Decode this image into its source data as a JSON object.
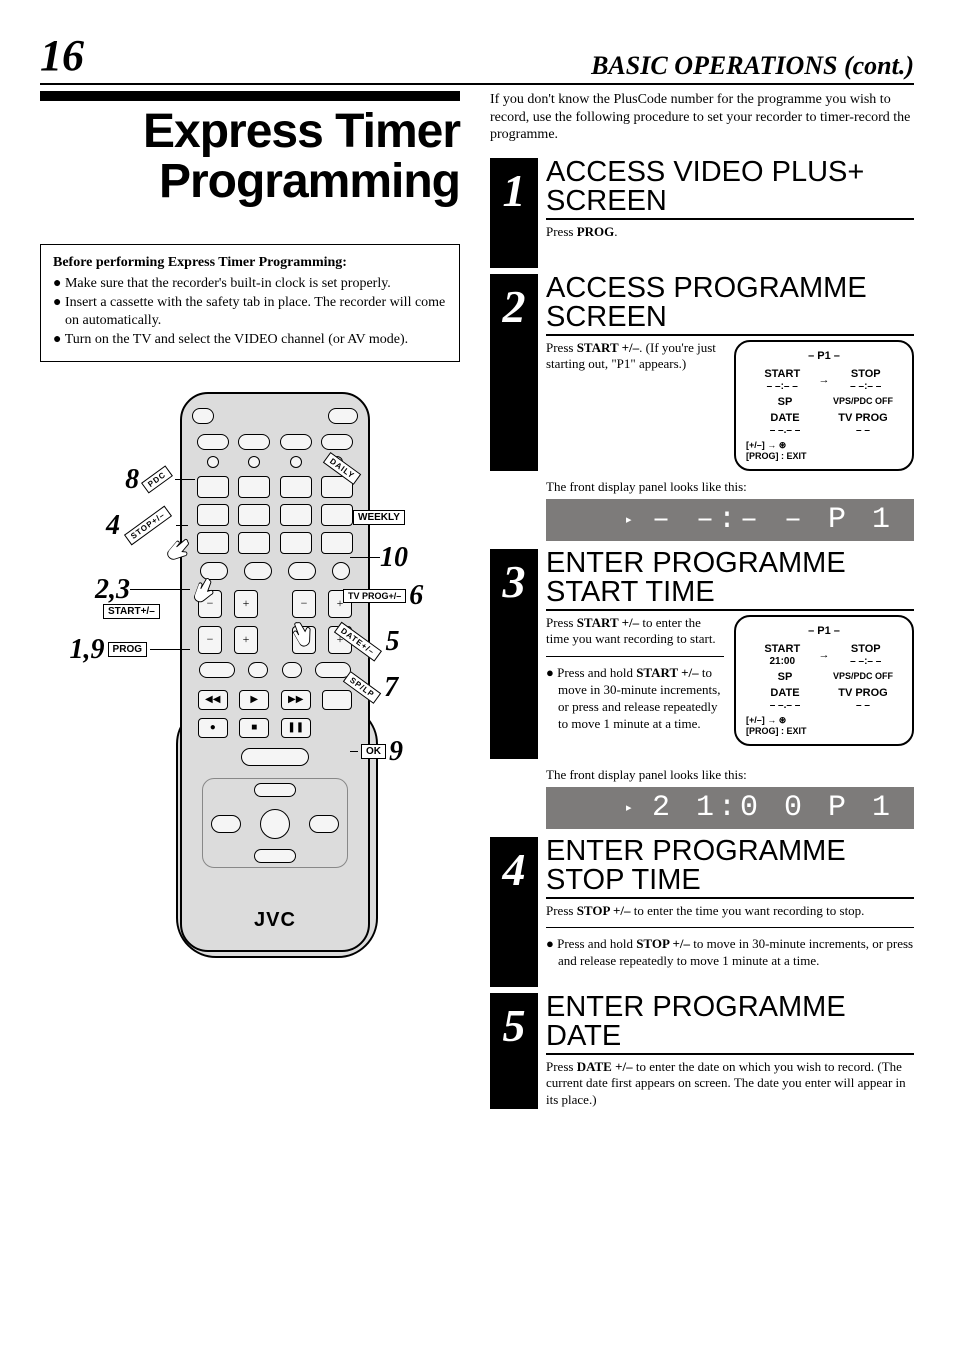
{
  "header": {
    "page_number": "16",
    "section": "BASIC OPERATIONS (cont.)"
  },
  "main_title": "Express Timer Programming",
  "prep": {
    "lead": "Before performing Express Timer Programming:",
    "items": [
      "Make sure that the recorder's built-in clock is set properly.",
      "Insert a cassette with the safety tab in place. The recorder will come on automatically.",
      "Turn on the TV and select the VIDEO channel (or AV mode)."
    ]
  },
  "remote": {
    "brand": "JVC",
    "callouts": {
      "c8": {
        "num": "8",
        "label": "PDC"
      },
      "c4": {
        "num": "4",
        "label": "STOP+/–"
      },
      "c23": {
        "num": "2,3",
        "label": "START+/–"
      },
      "c19": {
        "num": "1,9",
        "label": "PROG"
      },
      "cdaily": {
        "label": "DAILY"
      },
      "cweekly": {
        "label": "WEEKLY"
      },
      "c10": {
        "num": "10"
      },
      "c6": {
        "num": "6",
        "label": "TV PROG+/–"
      },
      "c5": {
        "num": "5",
        "label": "DATE+/–"
      },
      "c7": {
        "num": "7",
        "label": "SP/LP"
      },
      "c9": {
        "num": "9",
        "label": "OK"
      }
    }
  },
  "intro": "If you don't know the PlusCode number for the programme you wish to record, use the following procedure to set your recorder to timer-record the programme.",
  "steps": {
    "s1": {
      "num": "1",
      "title": "ACCESS VIDEO PLUS+ SCREEN",
      "text_pre": "Press ",
      "text_btn": "PROG",
      "text_post": "."
    },
    "s2": {
      "num": "2",
      "title": "ACCESS PROGRAMME SCREEN",
      "text_pre": "Press ",
      "text_btn": "START +/–",
      "text_post": ". (If you're just starting out, \"P1\" appears.)",
      "osd": {
        "header": "– P1 –",
        "start_lbl": "START",
        "start_val": "– –:– –",
        "arrow": "→",
        "stop_lbl": "STOP",
        "stop_val": "– –:– –",
        "sp": "SP",
        "vps": "VPS/PDC OFF",
        "date_lbl": "DATE",
        "date_val": "– –.– –",
        "tv_lbl": "TV PROG",
        "tv_val": "– –",
        "foot": "[+/–] → ⊛\n[PROG] : EXIT"
      },
      "panel_note": "The front display panel looks like this:",
      "vfd_rec": "▸",
      "vfd_text": "– –:– –  P 1"
    },
    "s3": {
      "num": "3",
      "title": "ENTER PROGRAMME START TIME",
      "text_pre": "Press ",
      "text_btn": "START +/–",
      "text_post": " to enter the time you want recording to start.",
      "bullet_pre": "Press and hold ",
      "bullet_btn": "START +/–",
      "bullet_post": " to move in 30-minute increments, or press and release repeatedly to move 1 minute at a time.",
      "osd": {
        "header": "– P1 –",
        "start_lbl": "START",
        "start_val": "21:00",
        "arrow": "→",
        "stop_lbl": "STOP",
        "stop_val": "– –:– –",
        "sp": "SP",
        "vps": "VPS/PDC OFF",
        "date_lbl": "DATE",
        "date_val": "– –.– –",
        "tv_lbl": "TV PROG",
        "tv_val": "– –",
        "foot": "[+/–] → ⊛\n[PROG] : EXIT"
      },
      "panel_note": "The front display panel looks like this:",
      "vfd_rec": "▸",
      "vfd_text": "2 1:0 0  P 1"
    },
    "s4": {
      "num": "4",
      "title": "ENTER PROGRAMME STOP TIME",
      "text_pre": "Press ",
      "text_btn": "STOP +/–",
      "text_post": " to enter the time you want recording to stop.",
      "bullet_pre": "Press and hold ",
      "bullet_btn": "STOP +/–",
      "bullet_post": " to move in 30-minute increments, or press and release repeatedly to move 1 minute at a time."
    },
    "s5": {
      "num": "5",
      "title": "ENTER PROGRAMME DATE",
      "text_pre": "Press ",
      "text_btn": "DATE +/–",
      "text_post": "  to enter the date on which you wish to record. (The current date first appears on screen. The date you enter will appear in its place.)"
    }
  }
}
